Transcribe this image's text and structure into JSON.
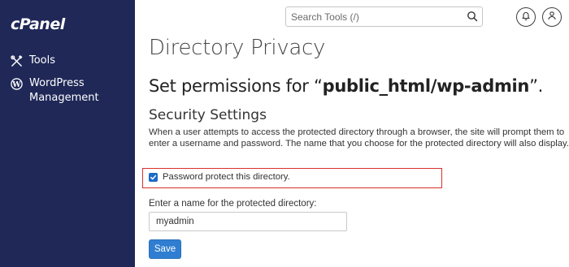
{
  "brand": {
    "logo_text": "cPanel"
  },
  "sidebar": {
    "items": [
      {
        "label": "Tools",
        "icon": "tools-icon"
      },
      {
        "label": "WordPress Management",
        "icon": "wordpress-icon"
      }
    ]
  },
  "header": {
    "search_placeholder": "Search Tools (/)",
    "icons": [
      "search-icon",
      "bell-icon",
      "user-icon"
    ]
  },
  "main": {
    "page_title": "Directory Privacy",
    "permissions_prefix": "Set permissions for “",
    "directory": "public_html/wp-admin",
    "permissions_suffix": "”.",
    "section_title": "Security Settings",
    "description": "When a user attempts to access the protected directory through a browser, the site will prompt them to enter a username and password. The name that you choose for the protected directory will also display.",
    "protect_checkbox": {
      "label": "Password protect this directory.",
      "checked": true
    },
    "name_field": {
      "label": "Enter a name for the protected directory:",
      "value": "myadmin"
    },
    "save_label": "Save"
  },
  "colors": {
    "sidebar_bg": "#1f2857",
    "primary_button": "#2f7ed1",
    "highlight_border": "#d9302b"
  }
}
